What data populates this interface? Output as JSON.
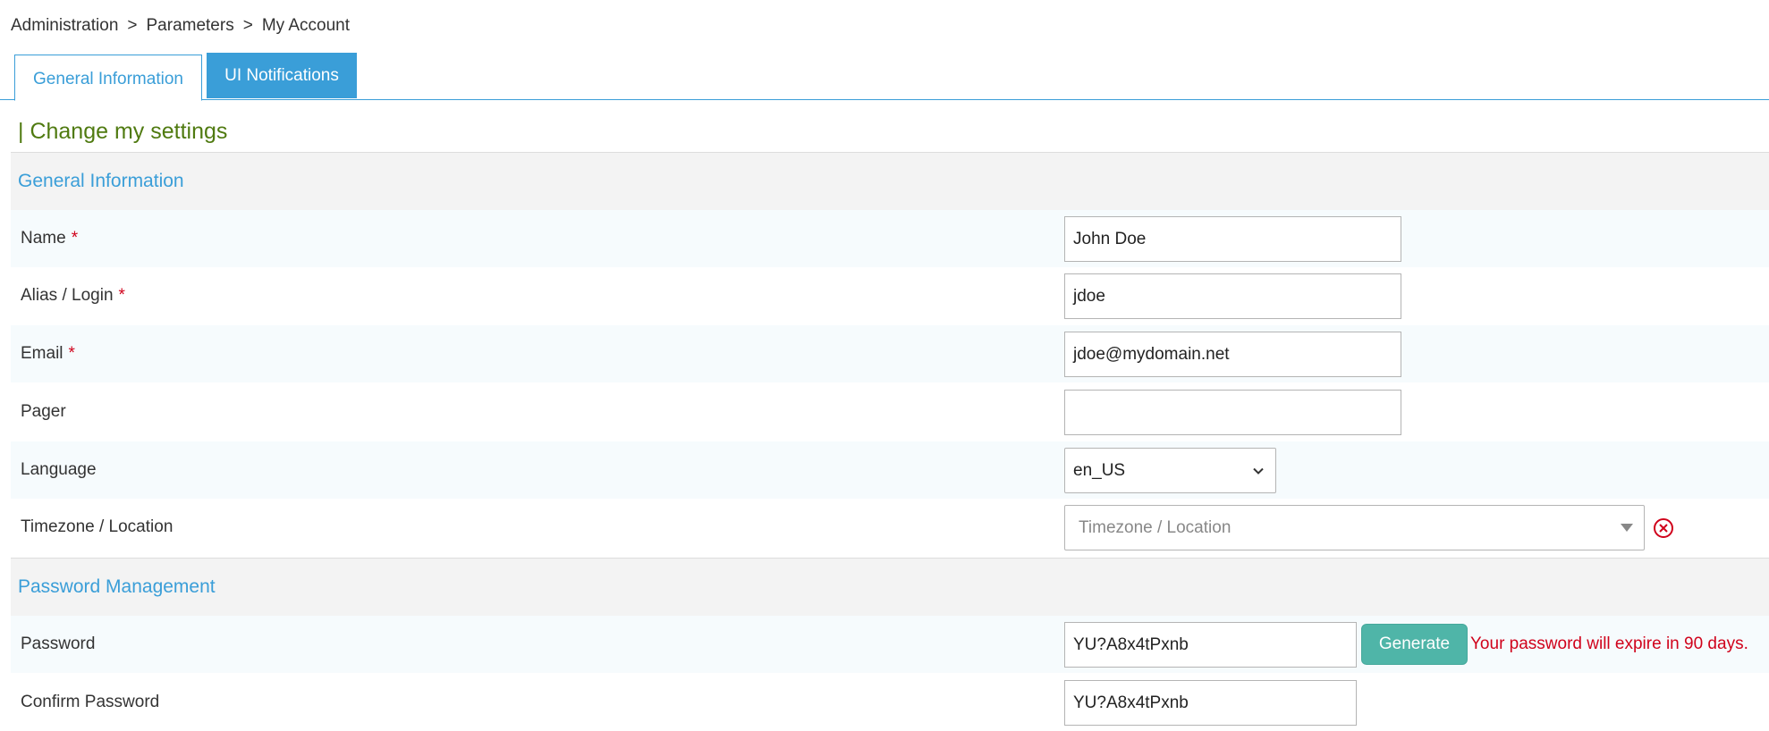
{
  "breadcrumb": {
    "items": [
      "Administration",
      "Parameters",
      "My Account"
    ],
    "separator": ">"
  },
  "tabs": {
    "general": "General Information",
    "ui_notifications": "UI Notifications"
  },
  "page_title": "| Change my settings",
  "sections": {
    "general": "General Information",
    "password": "Password Management"
  },
  "fields": {
    "name": {
      "label": "Name",
      "required": "*",
      "value": "John Doe"
    },
    "alias": {
      "label": "Alias / Login",
      "required": "*",
      "value": "jdoe"
    },
    "email": {
      "label": "Email",
      "required": "*",
      "value": "jdoe@mydomain.net"
    },
    "pager": {
      "label": "Pager",
      "value": ""
    },
    "language": {
      "label": "Language",
      "value": "en_US"
    },
    "timezone": {
      "label": "Timezone / Location",
      "placeholder": "Timezone / Location"
    },
    "password": {
      "label": "Password",
      "value": "YU?A8x4tPxnb"
    },
    "confirm_password": {
      "label": "Confirm Password",
      "value": "YU?A8x4tPxnb"
    }
  },
  "buttons": {
    "generate": "Generate"
  },
  "messages": {
    "password_expire": "Your password will expire in 90 days."
  },
  "colors": {
    "accent": "#3a9ed8",
    "title": "#4f7a10",
    "button": "#4fb5a8",
    "error": "#d0021b"
  },
  "icons": {
    "clear": "clear-circle-icon",
    "dropdown": "chevron-down-icon"
  }
}
